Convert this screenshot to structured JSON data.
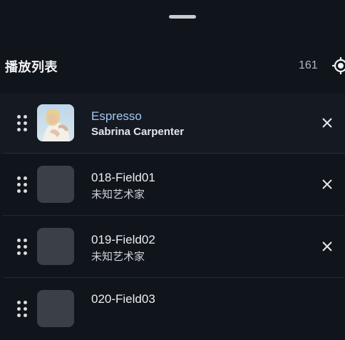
{
  "header": {
    "title": "播放列表",
    "count": "161",
    "locate_icon": "crosshair-locate-icon"
  },
  "icons": {
    "drag": "drag-handle-icon",
    "remove": "close-icon"
  },
  "playlist": [
    {
      "title": "Espresso",
      "artist": "Sabrina Carpenter",
      "playing": true,
      "has_artwork": true
    },
    {
      "title": "018-Field01",
      "artist": "未知艺术家",
      "playing": false,
      "has_artwork": false
    },
    {
      "title": "019-Field02",
      "artist": "未知艺术家",
      "playing": false,
      "has_artwork": false
    },
    {
      "title": "020-Field03",
      "artist": "",
      "playing": false,
      "has_artwork": false
    }
  ]
}
